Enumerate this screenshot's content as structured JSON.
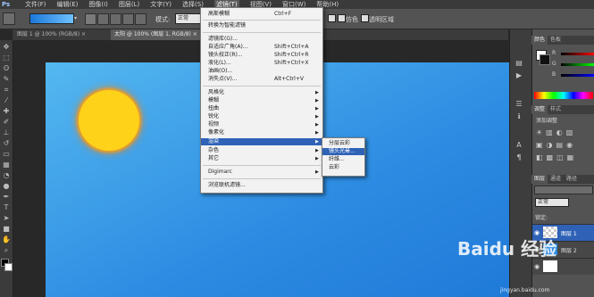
{
  "menubar": {
    "logo": "Ps",
    "items": [
      {
        "label": "文件(F)"
      },
      {
        "label": "编辑(E)"
      },
      {
        "label": "图像(I)"
      },
      {
        "label": "图层(L)"
      },
      {
        "label": "文字(Y)"
      },
      {
        "label": "选择(S)"
      },
      {
        "label": "滤镜(T)",
        "active": true
      },
      {
        "label": "视图(V)"
      },
      {
        "label": "窗口(W)"
      },
      {
        "label": "帮助(H)"
      }
    ]
  },
  "options": {
    "mode_label": "模式:",
    "mode_value": "正常",
    "reverse_label": "反向",
    "dither_label": "仿色",
    "transparency_label": "透明区域"
  },
  "tabs": [
    {
      "label": "图层 1 @ 100% (RGB/8) ×"
    },
    {
      "label": "太阳 @ 100% (图层 1, RGB/8) ×"
    }
  ],
  "filter_menu": {
    "items": [
      {
        "label": "高斯模糊",
        "shortcut": "Ctrl+F"
      },
      {
        "label": "转换为智能滤镜"
      },
      {
        "label": "滤镜库(G)..."
      },
      {
        "label": "自适应广角(A)...",
        "shortcut": "Shift+Ctrl+A"
      },
      {
        "label": "镜头校正(R)...",
        "shortcut": "Shift+Ctrl+R"
      },
      {
        "label": "液化(L)...",
        "shortcut": "Shift+Ctrl+X"
      },
      {
        "label": "油画(O)..."
      },
      {
        "label": "消失点(V)...",
        "shortcut": "Alt+Ctrl+V"
      },
      {
        "label": "风格化",
        "submenu": true
      },
      {
        "label": "模糊",
        "submenu": true
      },
      {
        "label": "扭曲",
        "submenu": true
      },
      {
        "label": "锐化",
        "submenu": true
      },
      {
        "label": "视频",
        "submenu": true
      },
      {
        "label": "像素化",
        "submenu": true
      },
      {
        "label": "渲染",
        "submenu": true,
        "highlighted": true
      },
      {
        "label": "杂色",
        "submenu": true
      },
      {
        "label": "其它",
        "submenu": true
      },
      {
        "label": "Digimarc",
        "submenu": true
      },
      {
        "label": "浏览联机滤镜..."
      }
    ]
  },
  "render_submenu": {
    "items": [
      {
        "label": "分层云彩"
      },
      {
        "label": "镜头光晕...",
        "highlighted": true
      },
      {
        "label": "纤维..."
      },
      {
        "label": "云彩"
      }
    ]
  },
  "right_panel": {
    "color_tabs": [
      "颜色",
      "色板"
    ],
    "adjust_tabs": [
      "调整",
      "样式"
    ],
    "adjust_title": "添加调整",
    "layer_tabs": [
      "图层",
      "通道",
      "路径"
    ],
    "blend_mode": "正常",
    "lock_label": "锁定:",
    "layers": [
      {
        "name": "图层 1",
        "active": true
      },
      {
        "name": "图层 2"
      },
      {
        "name": ""
      }
    ],
    "channel_labels": [
      "R",
      "G",
      "B"
    ]
  },
  "watermark": {
    "text": "Baidu 经验",
    "subtext": "jingyan.baidu.com"
  },
  "colors": {
    "highlight": "#2f62b6",
    "canvas_top": "#54b8f0",
    "canvas_bottom": "#1f7ad8",
    "sun": "#ffd21a"
  }
}
